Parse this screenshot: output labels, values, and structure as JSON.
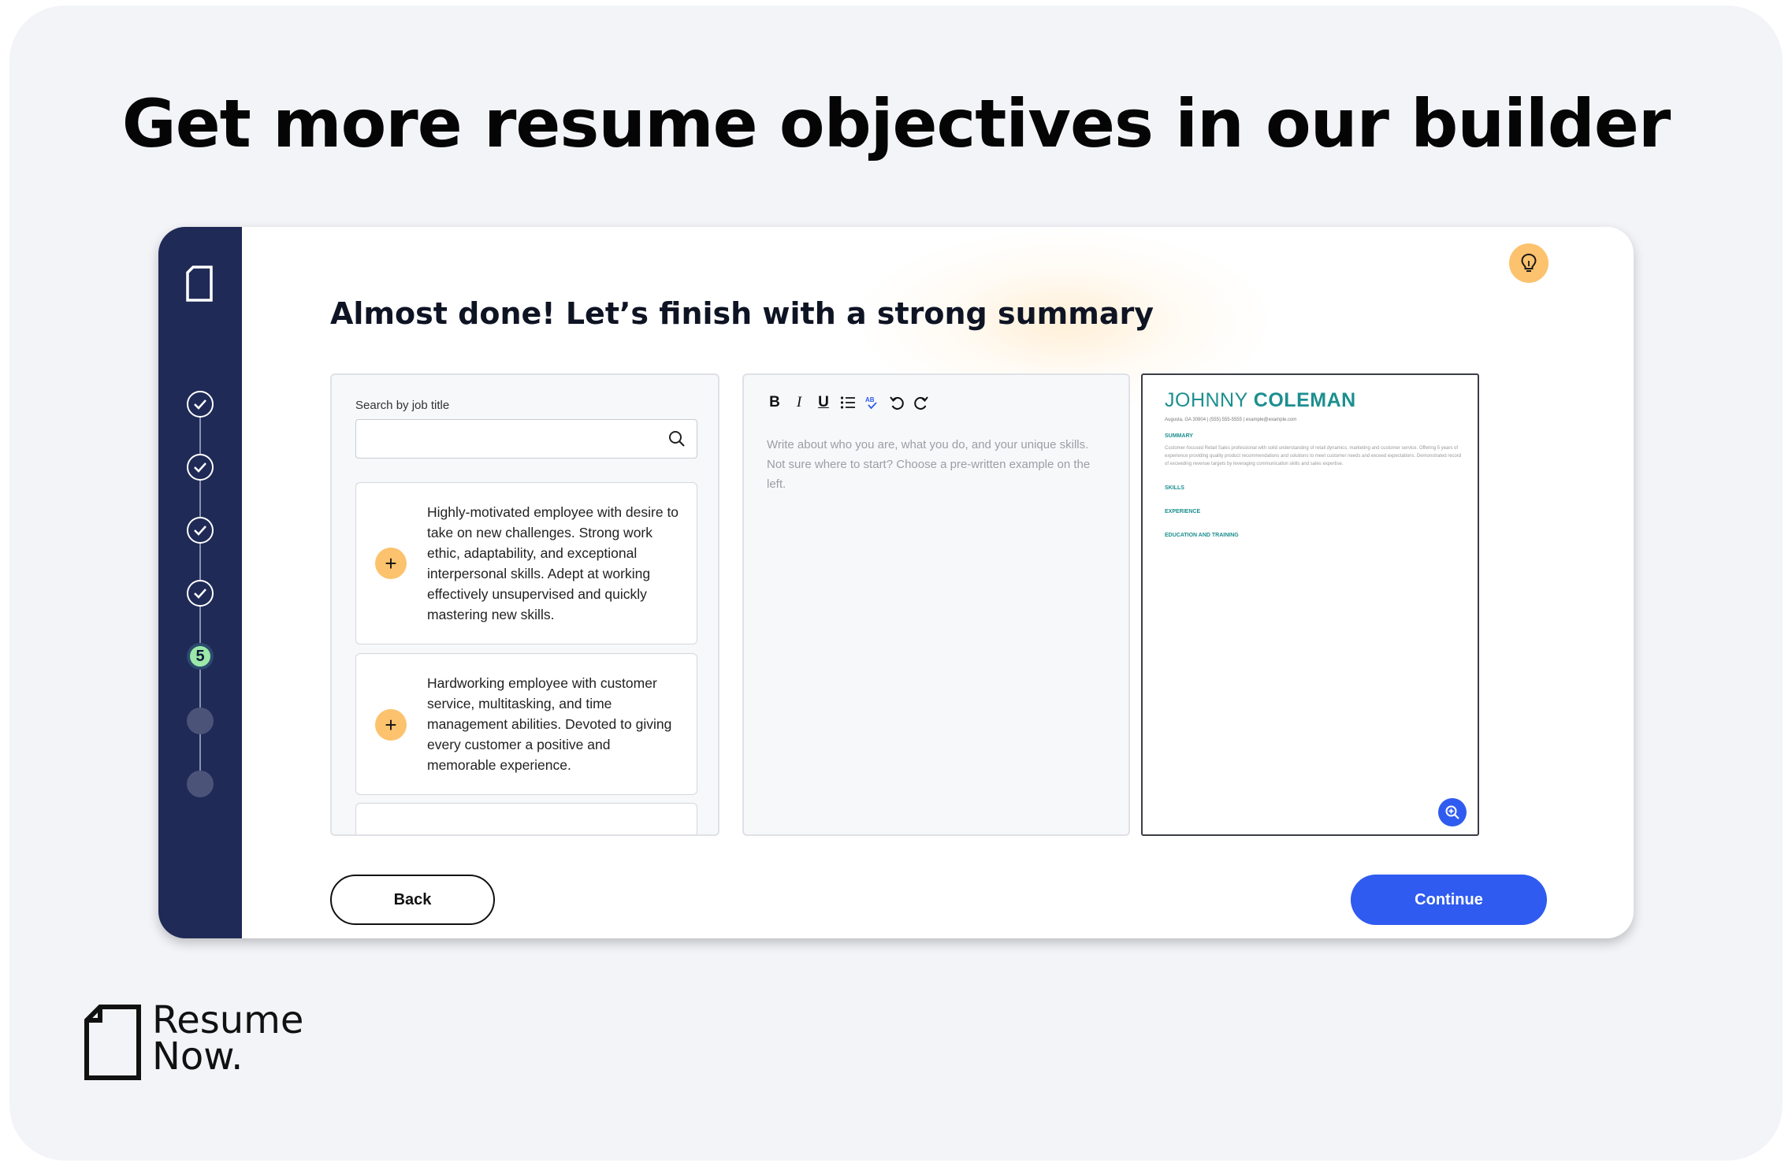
{
  "headline": "Get more resume objectives in our builder",
  "builder": {
    "title": "Almost done! Let’s finish with a strong summary",
    "current_step": "5",
    "search": {
      "label": "Search by job title",
      "value": "",
      "placeholder": ""
    },
    "examples": [
      {
        "text": "Highly-motivated employee with desire to take on new challenges. Strong work ethic, adaptability, and exceptional interpersonal skills. Adept at working effectively unsupervised and quickly mastering new skills."
      },
      {
        "text": "Hardworking employee with customer service, multitasking, and time management abilities. Devoted to giving every customer a positive and memorable experience."
      }
    ],
    "add_label": "+",
    "toolbar": {
      "bold": "B",
      "italic": "I",
      "underline": "U"
    },
    "editor_placeholder": "Write about who you are, what you do, and your unique skills. Not sure where to start? Choose a pre-written example on the left.",
    "back_label": "Back",
    "continue_label": "Continue"
  },
  "preview": {
    "first_name": "JOHNNY",
    "last_name": "COLEMAN",
    "contact": "Augusta, GA 30904 | (555) 555-5555 | example@example.com",
    "summary_heading": "SUMMARY",
    "summary_text": "Customer-focused Retail Sales professional with solid understanding of retail dynamics, marketing and customer service. Offering 5 years of experience providing quality product recommendations and solutions to meet customer needs and exceed expectations. Demonstrated record of exceeding revenue targets by leveraging communication skills and sales expertise.",
    "skills_heading": "SKILLS",
    "experience_heading": "EXPERIENCE",
    "education_heading": "EDUCATION AND TRAINING"
  },
  "brand": {
    "line1": "Resume",
    "line2": "Now."
  },
  "colors": {
    "sidebar": "#1f2a56",
    "accent": "#2f5bf0",
    "highlight": "#fcc26d",
    "teal": "#1d8f8f"
  },
  "icons": [
    "document-icon",
    "check-icon",
    "lightbulb-icon",
    "search-icon",
    "plus-icon",
    "zoom-in-icon",
    "undo-icon",
    "redo-icon",
    "list-icon",
    "spellcheck-icon"
  ]
}
